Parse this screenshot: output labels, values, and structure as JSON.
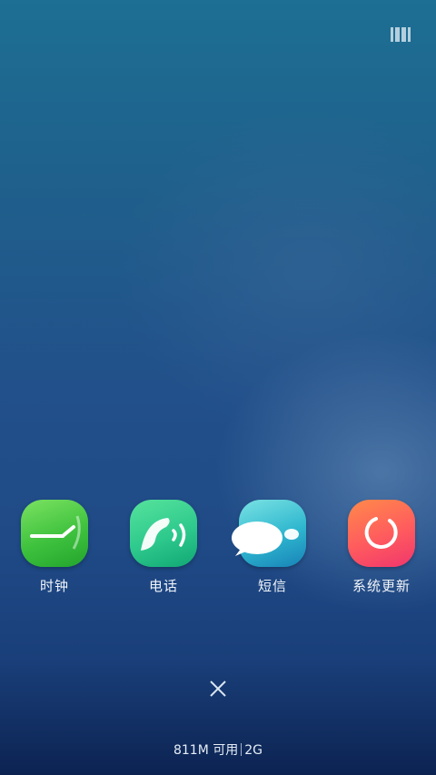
{
  "apps": [
    {
      "label": "时钟",
      "icon": "clock-icon"
    },
    {
      "label": "电话",
      "icon": "phone-icon"
    },
    {
      "label": "短信",
      "icon": "message-icon"
    },
    {
      "label": "系统更新",
      "icon": "update-icon"
    }
  ],
  "footer": {
    "memory": "811M 可用",
    "total": "2G"
  },
  "colors": {
    "clock": "#3fc23e",
    "phone": "#2ec98d",
    "sms": "#2fb7cf",
    "update": "#ff5b5e"
  }
}
